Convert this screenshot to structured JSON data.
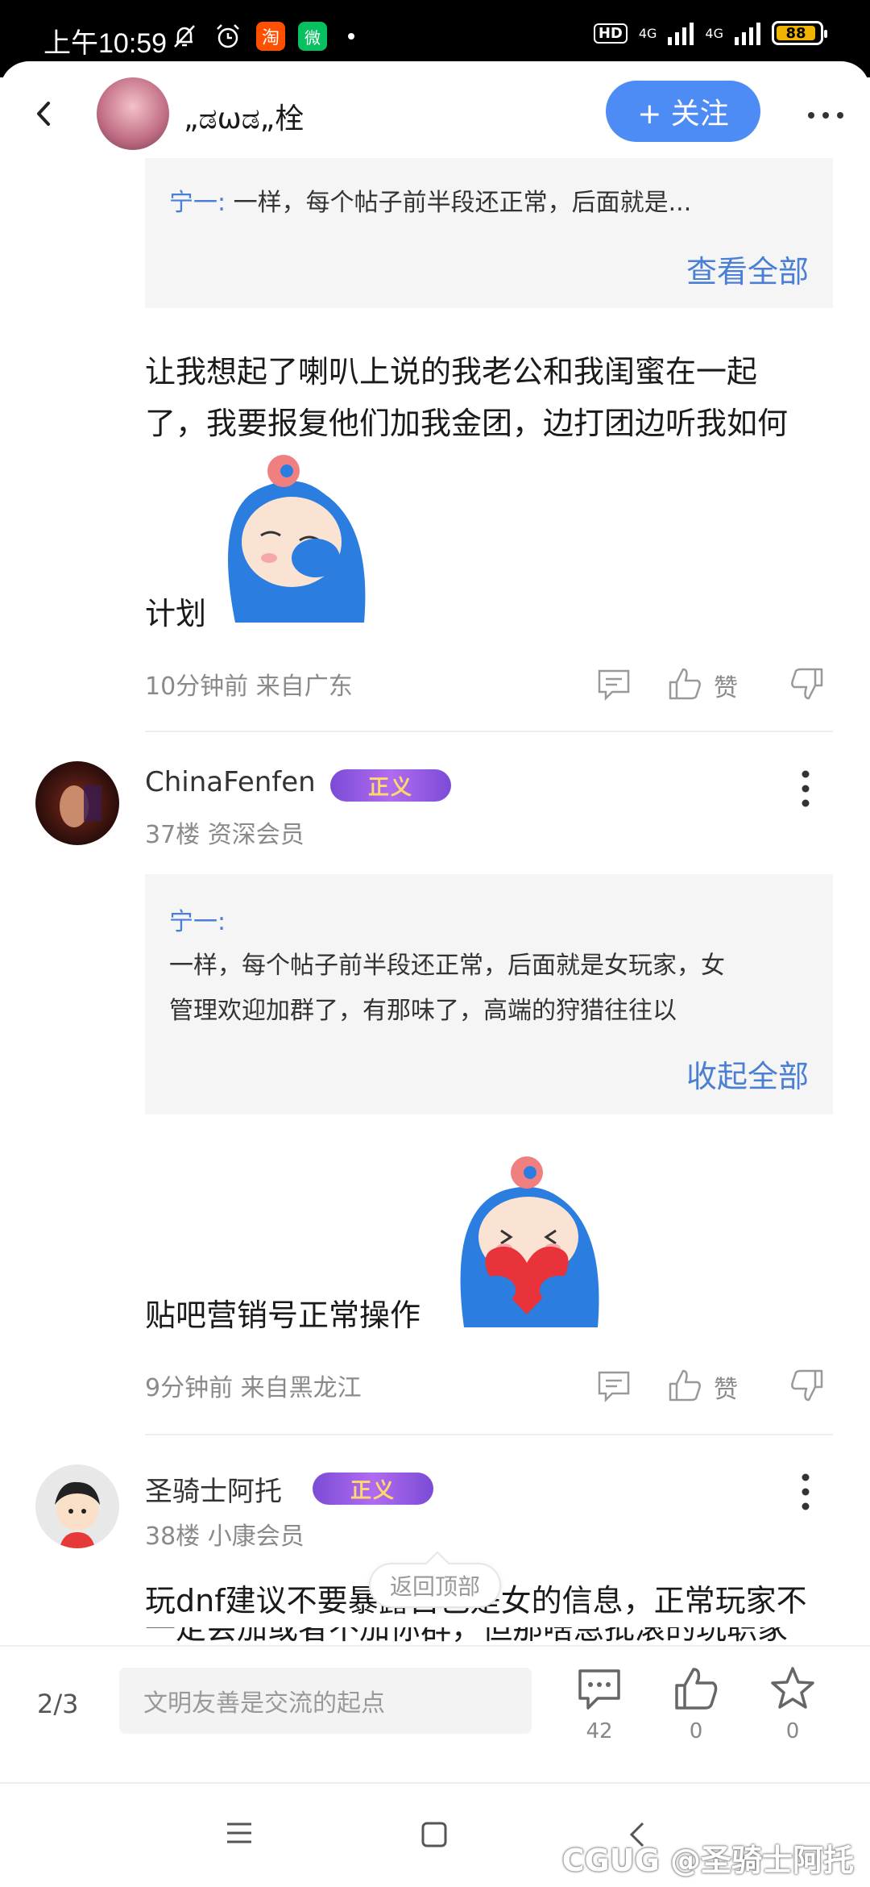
{
  "status_bar": {
    "time": "上午10:59",
    "hd": "HD",
    "network_1": "4G",
    "network_2": "4G",
    "battery": "88",
    "taobao_label": "淘",
    "wechat_label": "微"
  },
  "header": {
    "username": "„ಡωಡ„栓",
    "follow_label": "+ 关注"
  },
  "post1": {
    "quote_name": "宁一:",
    "quote_text": " 一样，每个帖子前半段还正常，后面就是...",
    "view_all": "查看全部",
    "body_line1": "让我想起了喇叭上说的我老公和我闺蜜在一起",
    "body_line2": "了，我要报复他们加我金团，边打团边听我如何",
    "body_line3": "计划",
    "meta": "10分钟前 来自广东",
    "zan": "赞"
  },
  "comment37": {
    "name": "ChinaFenfen",
    "badge": "正义",
    "floor": "37楼 资深会员",
    "quote_name": "宁一:",
    "quote_line1": "一样，每个帖子前半段还正常，后面就是女玩家，女",
    "quote_line2": "管理欢迎加群了，有那味了，高端的狩猎往往以",
    "collapse": "收起全部",
    "body": "贴吧营销号正常操作",
    "meta": "9分钟前 来自黑龙江",
    "zan": "赞"
  },
  "comment38": {
    "name": "圣骑士阿托",
    "badge": "正义",
    "floor": "38楼 小康会员",
    "body_line1": "玩dnf建议不要暴露自己是女的信息，正常玩家不",
    "body_line2": "一定会加或者不加你群，但那啥急批滚的玩职家"
  },
  "back_to_top": "返回顶部",
  "bottom_bar": {
    "page": "2/3",
    "input_placeholder": "文明友善是交流的起点",
    "comment_count": "42",
    "like_count": "0",
    "fav_count": "0"
  },
  "watermark": "CGUG @圣骑士阿托",
  "colors": {
    "accent": "#4e8cf5",
    "link": "#4a7fd4",
    "quote_bg": "#f5f5f5",
    "muted": "#8a8a8a"
  }
}
